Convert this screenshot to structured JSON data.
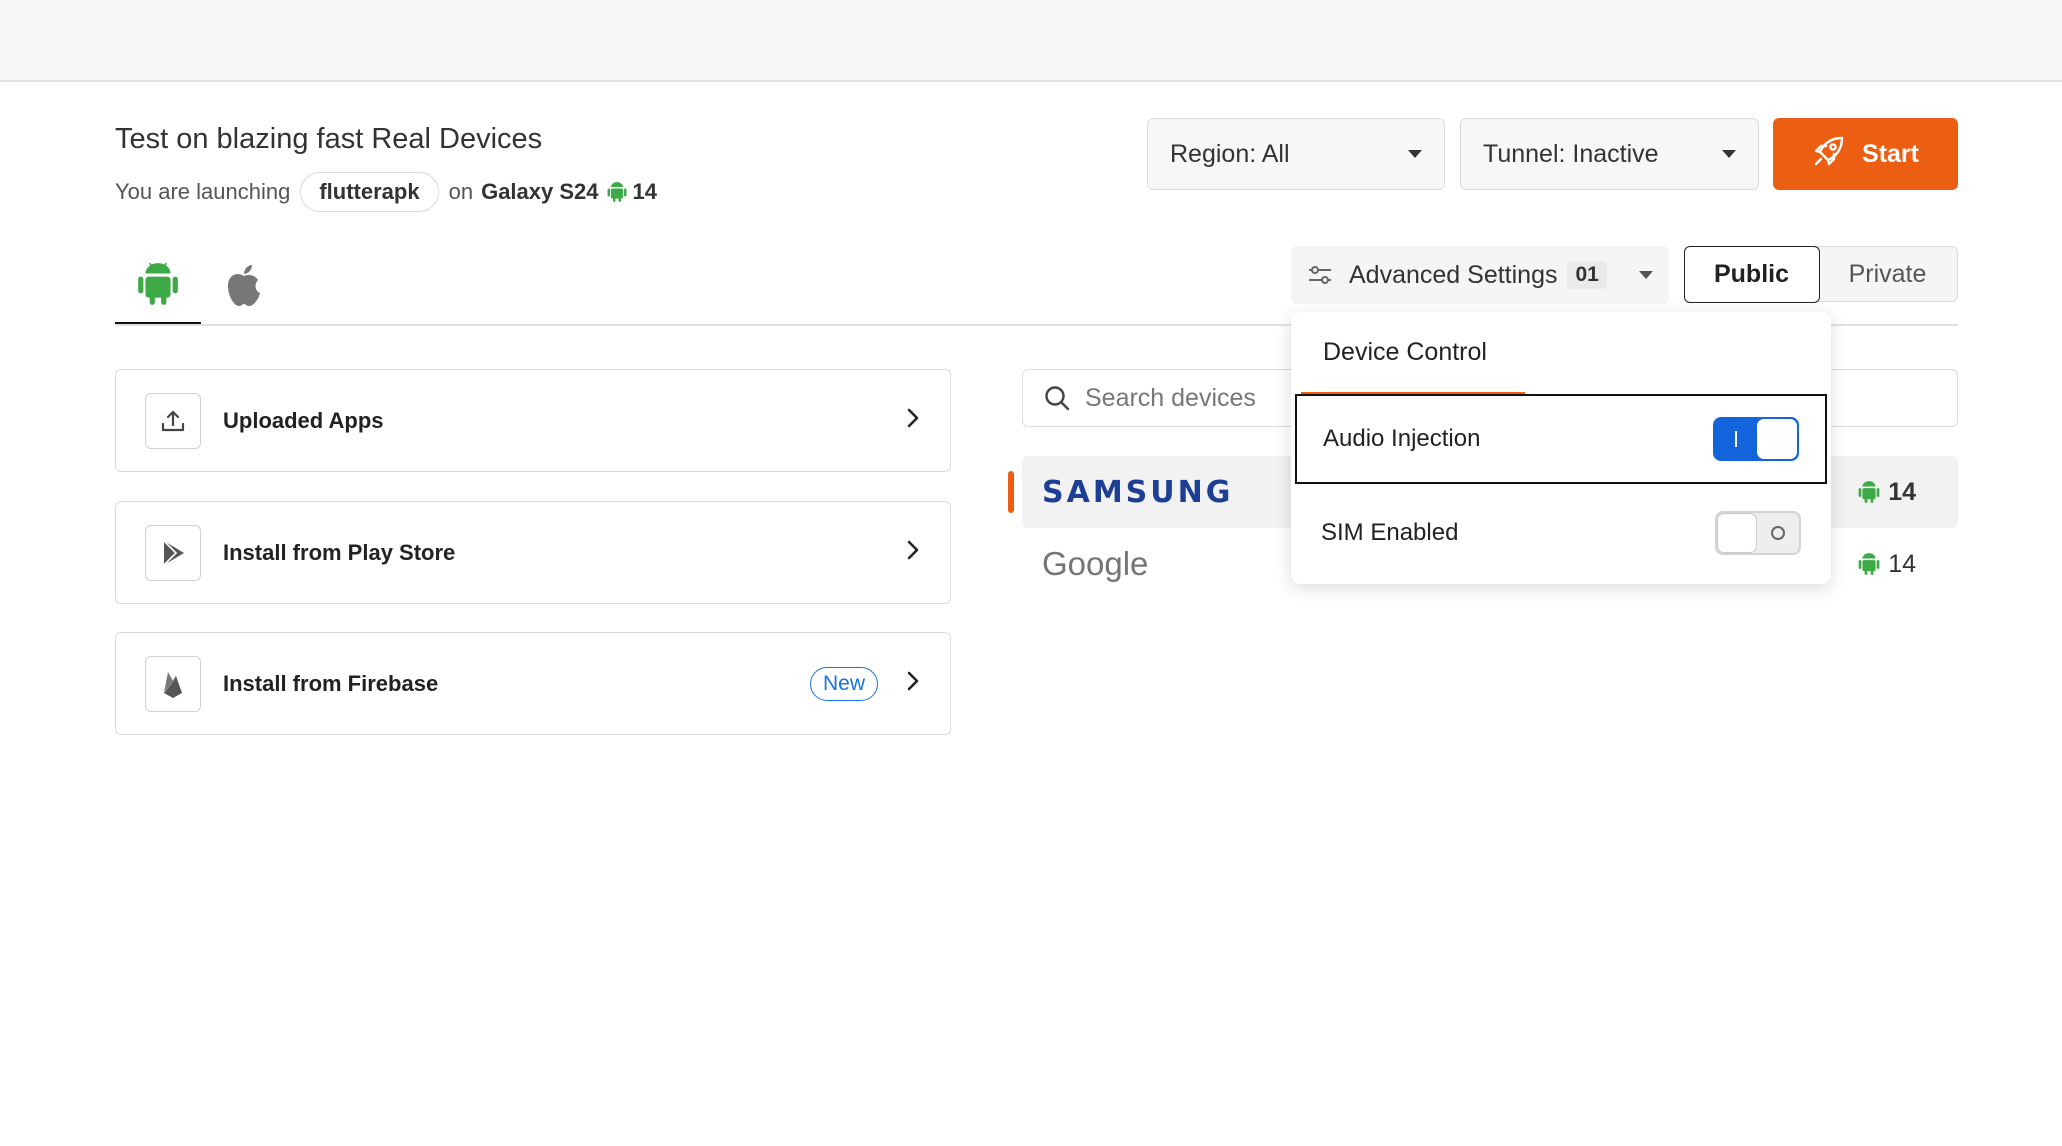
{
  "header": {
    "title": "Test on blazing fast Real Devices",
    "launch_prefix": "You are launching",
    "app_name": "flutterapk",
    "on_text": "on",
    "device_name": "Galaxy S24",
    "os_version": "14"
  },
  "controls": {
    "region_label": "Region: All",
    "tunnel_label": "Tunnel: Inactive",
    "start_label": "Start"
  },
  "os_tabs": [
    {
      "name": "android",
      "icon": "android-icon",
      "active": true
    },
    {
      "name": "ios",
      "icon": "apple-icon",
      "active": false
    }
  ],
  "advanced": {
    "label": "Advanced Settings",
    "count": "01"
  },
  "visibility": {
    "options": [
      "Public",
      "Private"
    ],
    "selected": "Public"
  },
  "app_sources": [
    {
      "label": "Uploaded Apps",
      "icon": "upload-icon",
      "badge": ""
    },
    {
      "label": "Install from Play Store",
      "icon": "play-store-icon",
      "badge": ""
    },
    {
      "label": "Install from Firebase",
      "icon": "firebase-icon",
      "badge": "New"
    }
  ],
  "devices": {
    "search_placeholder": "Search devices",
    "brands": [
      {
        "name": "SAMSUNG",
        "version": "14",
        "selected": true
      },
      {
        "name": "Google",
        "version": "14",
        "selected": false
      }
    ]
  },
  "popup": {
    "title": "Device Control",
    "toggles": [
      {
        "label": "Audio Injection",
        "on": true
      },
      {
        "label": "SIM Enabled",
        "on": false
      }
    ]
  },
  "colors": {
    "accent": "#ec5e12",
    "toggle_on": "#1465db",
    "android_green": "#3daa47",
    "samsung_blue": "#1c3e94",
    "new_badge": "#1a73e8"
  }
}
